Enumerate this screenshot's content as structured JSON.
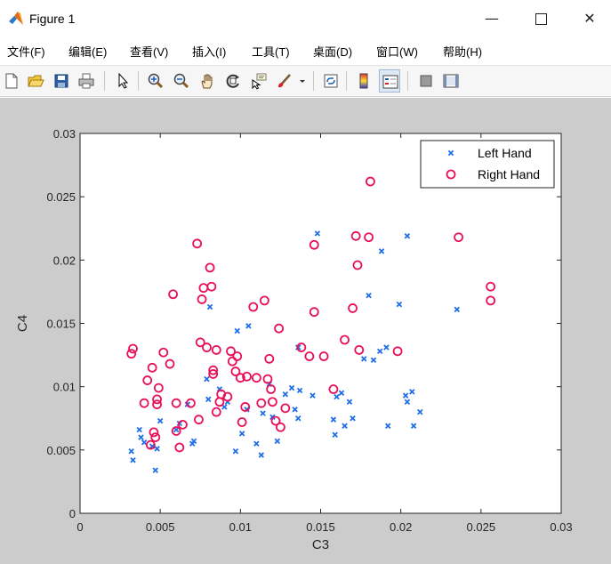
{
  "window": {
    "title": "Figure 1",
    "minimize_glyph": "—",
    "close_glyph": "✕"
  },
  "menu": [
    {
      "label": "文件(F)"
    },
    {
      "label": "编辑(E)"
    },
    {
      "label": "查看(V)"
    },
    {
      "label": "插入(I)"
    },
    {
      "label": "工具(T)"
    },
    {
      "label": "桌面(D)"
    },
    {
      "label": "窗口(W)"
    },
    {
      "label": "帮助(H)"
    }
  ],
  "toolbar": [
    {
      "icon": "new-figure-icon"
    },
    {
      "icon": "open-file-icon"
    },
    {
      "icon": "save-icon"
    },
    {
      "icon": "print-icon"
    },
    {
      "icon": "select-pointer-icon"
    },
    {
      "icon": "zoom-in-icon"
    },
    {
      "icon": "zoom-out-icon"
    },
    {
      "icon": "pan-hand-icon"
    },
    {
      "icon": "rotate-3d-icon"
    },
    {
      "icon": "data-cursor-icon"
    },
    {
      "icon": "brush-icon"
    },
    {
      "icon": "link-plot-icon"
    },
    {
      "icon": "colorbar-icon"
    },
    {
      "icon": "legend-icon"
    },
    {
      "icon": "hide-plot-tools-icon"
    },
    {
      "icon": "show-plot-tools-icon"
    }
  ],
  "colors": {
    "left_hand": "#1f6fe8",
    "right_hand": "#e8105a",
    "figure_bg": "#cccccc"
  },
  "chart_data": {
    "type": "scatter",
    "xlabel": "C3",
    "ylabel": "C4",
    "xlim": [
      0,
      0.03
    ],
    "ylim": [
      0,
      0.03
    ],
    "xticks": [
      "0",
      "0.005",
      "0.01",
      "0.015",
      "0.02",
      "0.025",
      "0.03"
    ],
    "yticks": [
      "0",
      "0.005",
      "0.01",
      "0.015",
      "0.02",
      "0.025",
      "0.03"
    ],
    "grid": false,
    "legend_position": "top-right",
    "series": [
      {
        "name": "Left Hand",
        "marker": "x",
        "color": "#1f6fe8",
        "points": [
          [
            0.0032,
            0.0049
          ],
          [
            0.0033,
            0.0042
          ],
          [
            0.0037,
            0.0066
          ],
          [
            0.0038,
            0.006
          ],
          [
            0.004,
            0.0056
          ],
          [
            0.0045,
            0.0053
          ],
          [
            0.0047,
            0.0034
          ],
          [
            0.0048,
            0.0051
          ],
          [
            0.005,
            0.0073
          ],
          [
            0.006,
            0.0066
          ],
          [
            0.0062,
            0.0071
          ],
          [
            0.0067,
            0.0086
          ],
          [
            0.007,
            0.0055
          ],
          [
            0.0071,
            0.0057
          ],
          [
            0.008,
            0.009
          ],
          [
            0.0081,
            0.0163
          ],
          [
            0.0079,
            0.0106
          ],
          [
            0.0087,
            0.0098
          ],
          [
            0.009,
            0.0084
          ],
          [
            0.0092,
            0.0088
          ],
          [
            0.0097,
            0.0049
          ],
          [
            0.0098,
            0.0144
          ],
          [
            0.0101,
            0.0063
          ],
          [
            0.0105,
            0.0148
          ],
          [
            0.0104,
            0.0082
          ],
          [
            0.011,
            0.0055
          ],
          [
            0.0113,
            0.0046
          ],
          [
            0.0114,
            0.0079
          ],
          [
            0.0118,
            0.0102
          ],
          [
            0.012,
            0.0076
          ],
          [
            0.0123,
            0.0057
          ],
          [
            0.0128,
            0.0094
          ],
          [
            0.0132,
            0.0099
          ],
          [
            0.0134,
            0.0082
          ],
          [
            0.0136,
            0.0075
          ],
          [
            0.0137,
            0.0097
          ],
          [
            0.0136,
            0.0131
          ],
          [
            0.0145,
            0.0093
          ],
          [
            0.0148,
            0.0221
          ],
          [
            0.0158,
            0.0074
          ],
          [
            0.0159,
            0.0062
          ],
          [
            0.016,
            0.0092
          ],
          [
            0.0163,
            0.0095
          ],
          [
            0.0165,
            0.0069
          ],
          [
            0.017,
            0.0075
          ],
          [
            0.0168,
            0.0088
          ],
          [
            0.0177,
            0.0122
          ],
          [
            0.018,
            0.0172
          ],
          [
            0.0183,
            0.0121
          ],
          [
            0.0187,
            0.0128
          ],
          [
            0.0188,
            0.0207
          ],
          [
            0.0191,
            0.0131
          ],
          [
            0.0192,
            0.0069
          ],
          [
            0.0199,
            0.0165
          ],
          [
            0.0203,
            0.0093
          ],
          [
            0.0204,
            0.0088
          ],
          [
            0.0204,
            0.0219
          ],
          [
            0.0207,
            0.0096
          ],
          [
            0.0208,
            0.0069
          ],
          [
            0.0212,
            0.008
          ],
          [
            0.0235,
            0.0161
          ]
        ]
      },
      {
        "name": "Right Hand",
        "marker": "o",
        "color": "#e8105a",
        "points": [
          [
            0.0032,
            0.0126
          ],
          [
            0.0033,
            0.013
          ],
          [
            0.004,
            0.0087
          ],
          [
            0.0042,
            0.0105
          ],
          [
            0.0044,
            0.0054
          ],
          [
            0.0045,
            0.0115
          ],
          [
            0.0046,
            0.0064
          ],
          [
            0.0047,
            0.006
          ],
          [
            0.0048,
            0.009
          ],
          [
            0.0048,
            0.0086
          ],
          [
            0.0049,
            0.0099
          ],
          [
            0.0052,
            0.0127
          ],
          [
            0.0056,
            0.0118
          ],
          [
            0.0058,
            0.0173
          ],
          [
            0.006,
            0.0087
          ],
          [
            0.006,
            0.0065
          ],
          [
            0.0062,
            0.0052
          ],
          [
            0.0064,
            0.007
          ],
          [
            0.0069,
            0.0087
          ],
          [
            0.0073,
            0.0213
          ],
          [
            0.0074,
            0.0074
          ],
          [
            0.0075,
            0.0135
          ],
          [
            0.0076,
            0.0169
          ],
          [
            0.0077,
            0.0178
          ],
          [
            0.0079,
            0.0131
          ],
          [
            0.0081,
            0.0194
          ],
          [
            0.0082,
            0.0179
          ],
          [
            0.0083,
            0.0113
          ],
          [
            0.0083,
            0.011
          ],
          [
            0.0085,
            0.008
          ],
          [
            0.0085,
            0.0129
          ],
          [
            0.0087,
            0.0088
          ],
          [
            0.0088,
            0.0094
          ],
          [
            0.0092,
            0.0092
          ],
          [
            0.0094,
            0.0128
          ],
          [
            0.0095,
            0.012
          ],
          [
            0.0097,
            0.0112
          ],
          [
            0.0098,
            0.0124
          ],
          [
            0.01,
            0.0107
          ],
          [
            0.0101,
            0.0072
          ],
          [
            0.0103,
            0.0084
          ],
          [
            0.0104,
            0.0108
          ],
          [
            0.0108,
            0.0163
          ],
          [
            0.011,
            0.0107
          ],
          [
            0.0113,
            0.0087
          ],
          [
            0.0115,
            0.0168
          ],
          [
            0.0117,
            0.0106
          ],
          [
            0.0118,
            0.0122
          ],
          [
            0.0119,
            0.0098
          ],
          [
            0.012,
            0.0088
          ],
          [
            0.0122,
            0.0073
          ],
          [
            0.0124,
            0.0146
          ],
          [
            0.0125,
            0.0068
          ],
          [
            0.0128,
            0.0083
          ],
          [
            0.0138,
            0.0131
          ],
          [
            0.0143,
            0.0124
          ],
          [
            0.0146,
            0.0212
          ],
          [
            0.0146,
            0.0159
          ],
          [
            0.0152,
            0.0124
          ],
          [
            0.0158,
            0.0098
          ],
          [
            0.0165,
            0.0137
          ],
          [
            0.017,
            0.0162
          ],
          [
            0.0172,
            0.0219
          ],
          [
            0.0173,
            0.0196
          ],
          [
            0.0174,
            0.0129
          ],
          [
            0.018,
            0.0218
          ],
          [
            0.0181,
            0.0262
          ],
          [
            0.0198,
            0.0128
          ],
          [
            0.0236,
            0.0218
          ],
          [
            0.0256,
            0.0179
          ],
          [
            0.0256,
            0.0168
          ]
        ]
      }
    ]
  }
}
